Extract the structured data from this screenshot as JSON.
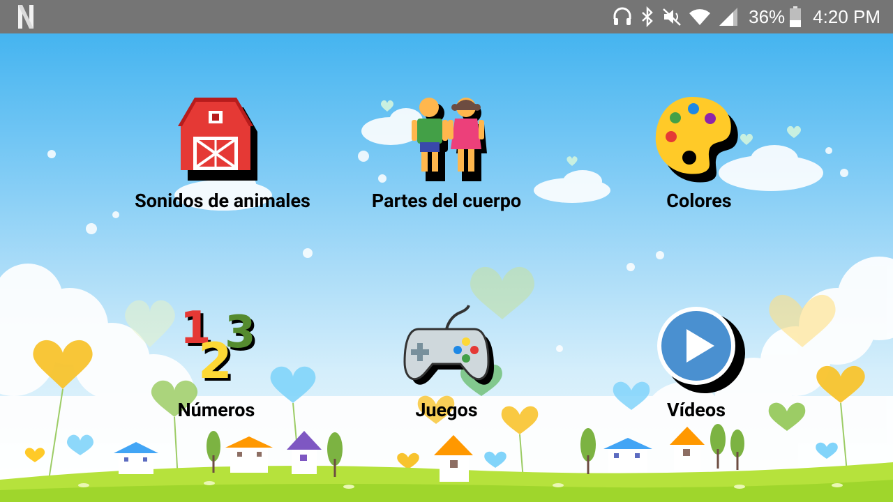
{
  "status_bar": {
    "app_icon": "netflix-n-icon",
    "icons": [
      "headphones-icon",
      "bluetooth-icon",
      "mute-icon",
      "wifi-icon",
      "signal-icon"
    ],
    "battery_percent": "36%",
    "time": "4:20 PM"
  },
  "menu": {
    "items": [
      {
        "label": "Sonidos de animales",
        "icon": "barn-icon"
      },
      {
        "label": "Partes del cuerpo",
        "icon": "kids-icon"
      },
      {
        "label": "Colores",
        "icon": "palette-icon"
      },
      {
        "label": "Números",
        "icon": "numbers-123-icon"
      },
      {
        "label": "Juegos",
        "icon": "gamepad-icon"
      },
      {
        "label": "Vídeos",
        "icon": "play-icon"
      }
    ]
  },
  "colors": {
    "status_bar": "#757575",
    "sky_top": "#45b4f0",
    "grass": "#a8dd34"
  }
}
